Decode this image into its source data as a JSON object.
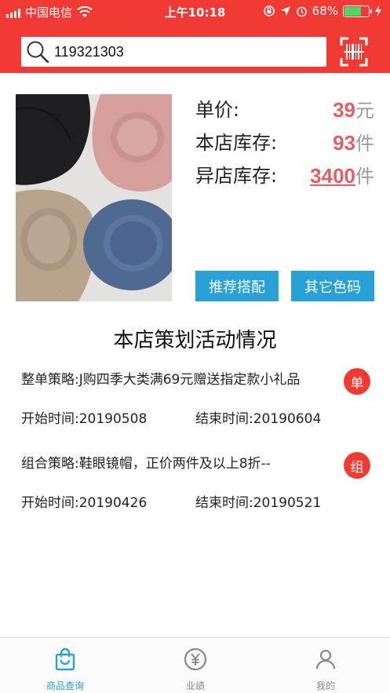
{
  "status_bar": {
    "carrier": "中国电信",
    "time": "上午10:18",
    "battery": "68%",
    "battery_level": 0.68
  },
  "search": {
    "value": "119321303",
    "icon": "search-icon",
    "scan_icon": "barcode-scan-icon"
  },
  "product": {
    "price_label": "单价:",
    "price": "39",
    "price_unit": "元",
    "store_stock_label": "本店库存:",
    "store_stock": "93",
    "store_stock_unit": "件",
    "other_stock_label": "异店库存:",
    "other_stock": "3400",
    "other_stock_unit": "件"
  },
  "buttons": {
    "recommend": "推荐搭配",
    "other_colors": "其它色码"
  },
  "section_title": "本店策划活动情况",
  "promotions": [
    {
      "title": "整单策略:J购四季大类满69元赠送指定款小礼品",
      "badge": "单",
      "start": "开始时间:20190508",
      "end": "结束时间:20190604"
    },
    {
      "title": "组合策略:鞋眼镜帽，正价两件及以上8折--",
      "badge": "组",
      "start": "开始时间:20190426",
      "end": "结束时间:20190521"
    }
  ],
  "tabs": [
    {
      "label": "商品查询",
      "icon": "shopping-bag-icon",
      "active": true
    },
    {
      "label": "业绩",
      "icon": "yuan-icon",
      "active": false
    },
    {
      "label": "我的",
      "icon": "user-icon",
      "active": false
    }
  ],
  "colors": {
    "header": "#f23a35",
    "accent": "#2aa0d9",
    "price": "#e06065"
  }
}
